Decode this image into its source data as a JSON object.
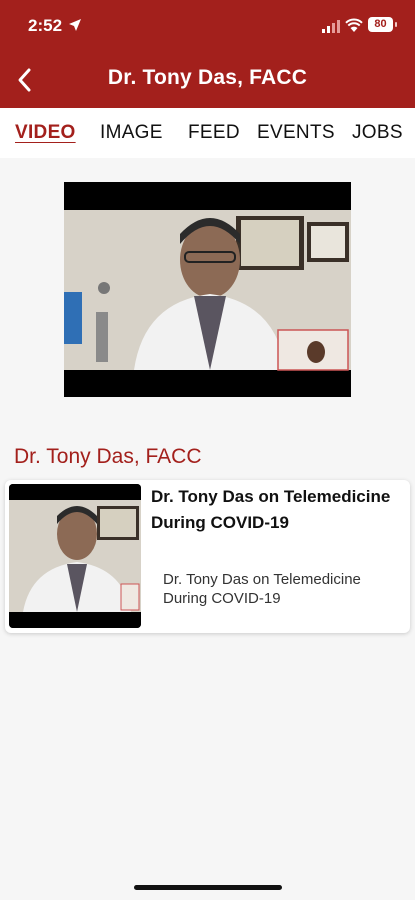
{
  "status_bar": {
    "time": "2:52",
    "battery": "80"
  },
  "header": {
    "title": "Dr. Tony Das, FACC"
  },
  "tabs": [
    {
      "label": "VIDEO",
      "active": true
    },
    {
      "label": "IMAGE",
      "active": false
    },
    {
      "label": "FEED",
      "active": false
    },
    {
      "label": "EVENTS",
      "active": false
    },
    {
      "label": "JOBS",
      "active": false
    }
  ],
  "section": {
    "title": "Dr. Tony Das, FACC"
  },
  "videos": [
    {
      "title": "Dr. Tony Das on Telemedicine During COVID-19",
      "description": "Dr. Tony Das on Telemedicine During COVID-19"
    }
  ],
  "colors": {
    "brand": "#a3201c",
    "background": "#f6f6f6"
  }
}
